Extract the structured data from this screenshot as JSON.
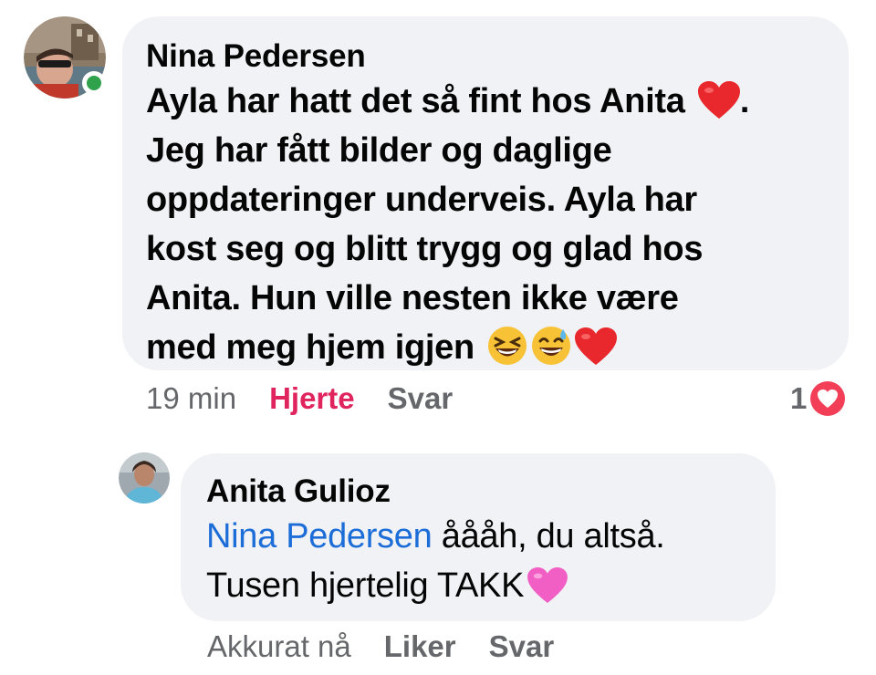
{
  "comment": {
    "author": "Nina Pedersen",
    "lines": [
      "Ayla har hatt det så fint hos Anita",
      "Jeg har fått bilder og daglige",
      "oppdateringer underveis. Ayla har",
      "kost seg og blitt trygg og glad hos",
      "Anita. Hun ville nesten ikke være",
      "med meg hjem igjen"
    ],
    "line1_suffix": ".",
    "emojis": [
      "red-heart",
      "grinning-squinting-face",
      "grinning-face-with-sweat",
      "red-heart"
    ],
    "timestamp": "19 min",
    "like_label": "Hjerte",
    "reply_label": "Svar",
    "reaction_count": "1",
    "online": true,
    "colors": {
      "bubble": "#f0f2f5",
      "liked": "#e0245e",
      "online": "#31a24c",
      "reaction_heart": "#f33e58"
    }
  },
  "reply": {
    "author": "Anita Gulioz",
    "mention": "Nina Pedersen",
    "line1_rest": " åååh, du altså.",
    "line2": "Tusen hjertelig TAKK",
    "emojis": [
      "pink-heart"
    ],
    "timestamp": "Akkurat nå",
    "like_label": "Liker",
    "reply_label": "Svar",
    "colors": {
      "mention": "#1c6dd8"
    }
  }
}
